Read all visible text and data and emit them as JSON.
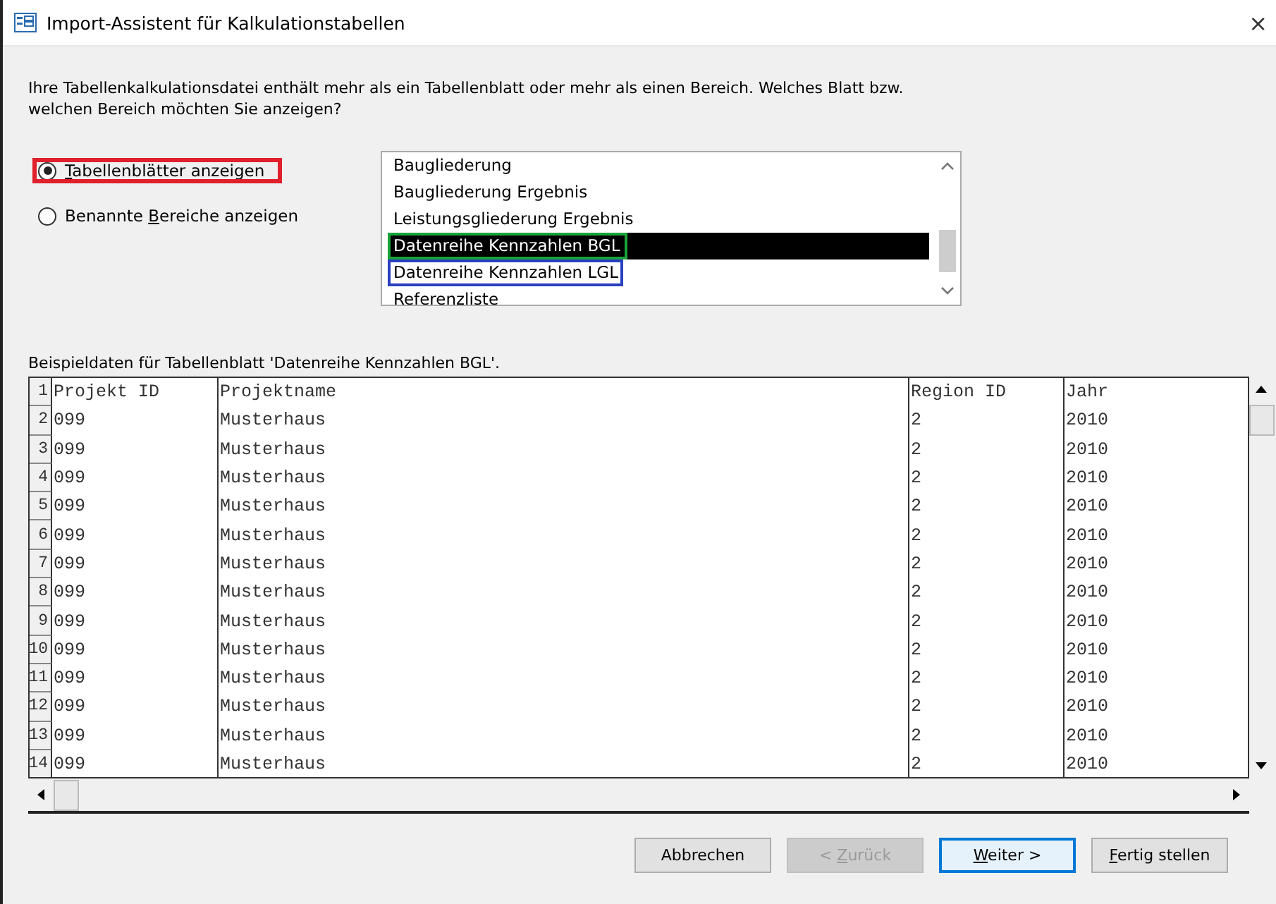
{
  "window": {
    "title": "Import-Assistent für Kalkulationstabellen",
    "close": "×"
  },
  "intro": "Ihre Tabellenkalkulationsdatei enthält mehr als ein Tabellenblatt oder mehr als einen Bereich. Welches Blatt bzw. welchen Bereich möchten Sie anzeigen?",
  "options": [
    {
      "accel": "T",
      "rest": "abellenblätter anzeigen",
      "selected": true,
      "color": "#e0202a"
    },
    {
      "accel": "B",
      "rest": "ereiche anzeigen",
      "before": "Benannte ",
      "selected": false
    }
  ],
  "sheets": [
    {
      "label": "Baugliederung",
      "selected": false
    },
    {
      "label": "Baugliederung Ergebnis",
      "selected": false
    },
    {
      "label": "Leistungsgliederung Ergebnis",
      "selected": false
    },
    {
      "label": "Datenreihe Kennzahlen BGL",
      "selected": true,
      "color": "#1aa33a"
    },
    {
      "label": "Datenreihe Kennzahlen LGL",
      "selected": false,
      "color": "#2a3fc0"
    },
    {
      "label": "Referenzliste",
      "selected": false
    }
  ],
  "preview_label": "Beispieldaten für Tabellenblatt 'Datenreihe Kennzahlen BGL'.",
  "grid": {
    "rows": [
      {
        "number": "1",
        "cells": [
          "Projekt ID",
          "Projektname",
          "Region ID",
          "Jahr"
        ]
      },
      {
        "number": "2",
        "cells": [
          "099",
          "Musterhaus",
          "2",
          "2010"
        ]
      },
      {
        "number": "3",
        "cells": [
          "099",
          "Musterhaus",
          "2",
          "2010"
        ]
      },
      {
        "number": "4",
        "cells": [
          "099",
          "Musterhaus",
          "2",
          "2010"
        ]
      },
      {
        "number": "5",
        "cells": [
          "099",
          "Musterhaus",
          "2",
          "2010"
        ]
      },
      {
        "number": "6",
        "cells": [
          "099",
          "Musterhaus",
          "2",
          "2010"
        ]
      },
      {
        "number": "7",
        "cells": [
          "099",
          "Musterhaus",
          "2",
          "2010"
        ]
      },
      {
        "number": "8",
        "cells": [
          "099",
          "Musterhaus",
          "2",
          "2010"
        ]
      },
      {
        "number": "9",
        "cells": [
          "099",
          "Musterhaus",
          "2",
          "2010"
        ]
      },
      {
        "number": "10",
        "cells": [
          "099",
          "Musterhaus",
          "2",
          "2010"
        ]
      },
      {
        "number": "11",
        "cells": [
          "099",
          "Musterhaus",
          "2",
          "2010"
        ]
      },
      {
        "number": "12",
        "cells": [
          "099",
          "Musterhaus",
          "2",
          "2010"
        ]
      },
      {
        "number": "13",
        "cells": [
          "099",
          "Musterhaus",
          "2",
          "2010"
        ]
      },
      {
        "number": "14",
        "cells": [
          "099",
          "Musterhaus",
          "2",
          "2010"
        ]
      }
    ]
  },
  "buttons": [
    {
      "rest": "Abbrechen",
      "disabled": false,
      "default": false
    },
    {
      "before": "< ",
      "accel": "Z",
      "rest": "urück",
      "disabled": true,
      "default": false
    },
    {
      "accel": "W",
      "rest": "eiter >",
      "disabled": false,
      "default": true
    },
    {
      "accel": "F",
      "rest": "ertig stellen",
      "disabled": false,
      "default": false
    }
  ]
}
